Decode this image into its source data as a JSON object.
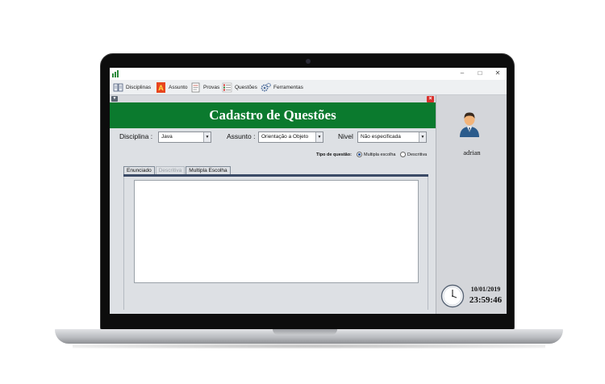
{
  "toolbar": {
    "items": [
      {
        "label": "Disciplinas",
        "icon": "book-icon"
      },
      {
        "label": "Assunto",
        "icon": "letter-a-icon"
      },
      {
        "label": "Provas",
        "icon": "exam-icon"
      },
      {
        "label": "Questões",
        "icon": "questions-icon"
      },
      {
        "label": "Ferramentas",
        "icon": "gears-icon"
      }
    ]
  },
  "window": {
    "minimize": "–",
    "maximize": "□",
    "close": "✕"
  },
  "form": {
    "title": "Cadastro de Questões",
    "disciplina_label": "Disciplina :",
    "disciplina_value": "Java",
    "assunto_label": "Assunto :",
    "assunto_value": "Orientação a Objeto",
    "nivel_label": "Nivel",
    "nivel_value": "Não especificada",
    "tipo_label": "Tipo de questão:",
    "radio_multipla": "Multipla escolha",
    "radio_descritiva": "Descritiva",
    "selected_tipo": "Multipla escolha",
    "tabs": [
      "Enunciado",
      "Descritiva",
      "Multipla Escolha"
    ]
  },
  "side": {
    "username": "adrian",
    "date": "10/01/2019",
    "time": "23:59:46"
  },
  "colors": {
    "banner": "#0b7a2e",
    "close_button": "#d9302c"
  }
}
